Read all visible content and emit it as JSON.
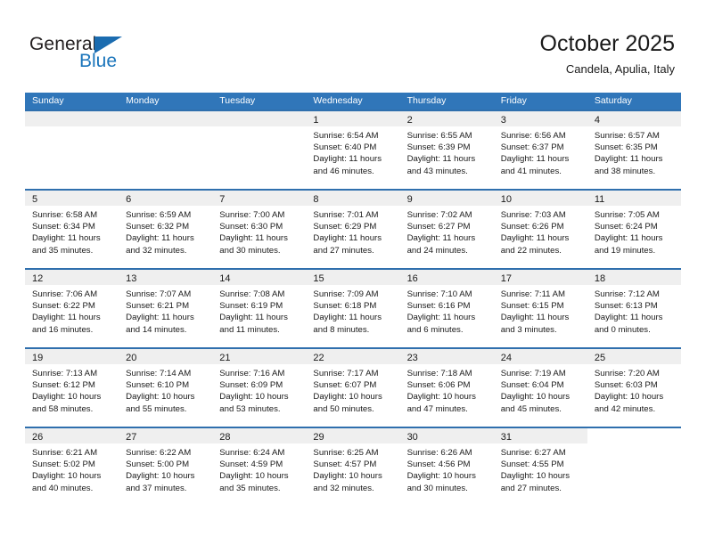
{
  "brand": {
    "name_part1": "General",
    "name_part2": "Blue",
    "triangle_color": "#1b6cb0",
    "blue_color": "#1b75bb"
  },
  "header": {
    "title": "October 2025",
    "subtitle": "Candela, Apulia, Italy",
    "accent_color": "#3076b9"
  },
  "weekdays": [
    "Sunday",
    "Monday",
    "Tuesday",
    "Wednesday",
    "Thursday",
    "Friday",
    "Saturday"
  ],
  "weeks": [
    [
      {
        "day": "",
        "blank": true
      },
      {
        "day": "",
        "blank": true
      },
      {
        "day": "",
        "blank": true
      },
      {
        "day": "1",
        "sunrise": "Sunrise: 6:54 AM",
        "sunset": "Sunset: 6:40 PM",
        "daylight1": "Daylight: 11 hours",
        "daylight2": "and 46 minutes."
      },
      {
        "day": "2",
        "sunrise": "Sunrise: 6:55 AM",
        "sunset": "Sunset: 6:39 PM",
        "daylight1": "Daylight: 11 hours",
        "daylight2": "and 43 minutes."
      },
      {
        "day": "3",
        "sunrise": "Sunrise: 6:56 AM",
        "sunset": "Sunset: 6:37 PM",
        "daylight1": "Daylight: 11 hours",
        "daylight2": "and 41 minutes."
      },
      {
        "day": "4",
        "sunrise": "Sunrise: 6:57 AM",
        "sunset": "Sunset: 6:35 PM",
        "daylight1": "Daylight: 11 hours",
        "daylight2": "and 38 minutes."
      }
    ],
    [
      {
        "day": "5",
        "sunrise": "Sunrise: 6:58 AM",
        "sunset": "Sunset: 6:34 PM",
        "daylight1": "Daylight: 11 hours",
        "daylight2": "and 35 minutes."
      },
      {
        "day": "6",
        "sunrise": "Sunrise: 6:59 AM",
        "sunset": "Sunset: 6:32 PM",
        "daylight1": "Daylight: 11 hours",
        "daylight2": "and 32 minutes."
      },
      {
        "day": "7",
        "sunrise": "Sunrise: 7:00 AM",
        "sunset": "Sunset: 6:30 PM",
        "daylight1": "Daylight: 11 hours",
        "daylight2": "and 30 minutes."
      },
      {
        "day": "8",
        "sunrise": "Sunrise: 7:01 AM",
        "sunset": "Sunset: 6:29 PM",
        "daylight1": "Daylight: 11 hours",
        "daylight2": "and 27 minutes."
      },
      {
        "day": "9",
        "sunrise": "Sunrise: 7:02 AM",
        "sunset": "Sunset: 6:27 PM",
        "daylight1": "Daylight: 11 hours",
        "daylight2": "and 24 minutes."
      },
      {
        "day": "10",
        "sunrise": "Sunrise: 7:03 AM",
        "sunset": "Sunset: 6:26 PM",
        "daylight1": "Daylight: 11 hours",
        "daylight2": "and 22 minutes."
      },
      {
        "day": "11",
        "sunrise": "Sunrise: 7:05 AM",
        "sunset": "Sunset: 6:24 PM",
        "daylight1": "Daylight: 11 hours",
        "daylight2": "and 19 minutes."
      }
    ],
    [
      {
        "day": "12",
        "sunrise": "Sunrise: 7:06 AM",
        "sunset": "Sunset: 6:22 PM",
        "daylight1": "Daylight: 11 hours",
        "daylight2": "and 16 minutes."
      },
      {
        "day": "13",
        "sunrise": "Sunrise: 7:07 AM",
        "sunset": "Sunset: 6:21 PM",
        "daylight1": "Daylight: 11 hours",
        "daylight2": "and 14 minutes."
      },
      {
        "day": "14",
        "sunrise": "Sunrise: 7:08 AM",
        "sunset": "Sunset: 6:19 PM",
        "daylight1": "Daylight: 11 hours",
        "daylight2": "and 11 minutes."
      },
      {
        "day": "15",
        "sunrise": "Sunrise: 7:09 AM",
        "sunset": "Sunset: 6:18 PM",
        "daylight1": "Daylight: 11 hours",
        "daylight2": "and 8 minutes."
      },
      {
        "day": "16",
        "sunrise": "Sunrise: 7:10 AM",
        "sunset": "Sunset: 6:16 PM",
        "daylight1": "Daylight: 11 hours",
        "daylight2": "and 6 minutes."
      },
      {
        "day": "17",
        "sunrise": "Sunrise: 7:11 AM",
        "sunset": "Sunset: 6:15 PM",
        "daylight1": "Daylight: 11 hours",
        "daylight2": "and 3 minutes."
      },
      {
        "day": "18",
        "sunrise": "Sunrise: 7:12 AM",
        "sunset": "Sunset: 6:13 PM",
        "daylight1": "Daylight: 11 hours",
        "daylight2": "and 0 minutes."
      }
    ],
    [
      {
        "day": "19",
        "sunrise": "Sunrise: 7:13 AM",
        "sunset": "Sunset: 6:12 PM",
        "daylight1": "Daylight: 10 hours",
        "daylight2": "and 58 minutes."
      },
      {
        "day": "20",
        "sunrise": "Sunrise: 7:14 AM",
        "sunset": "Sunset: 6:10 PM",
        "daylight1": "Daylight: 10 hours",
        "daylight2": "and 55 minutes."
      },
      {
        "day": "21",
        "sunrise": "Sunrise: 7:16 AM",
        "sunset": "Sunset: 6:09 PM",
        "daylight1": "Daylight: 10 hours",
        "daylight2": "and 53 minutes."
      },
      {
        "day": "22",
        "sunrise": "Sunrise: 7:17 AM",
        "sunset": "Sunset: 6:07 PM",
        "daylight1": "Daylight: 10 hours",
        "daylight2": "and 50 minutes."
      },
      {
        "day": "23",
        "sunrise": "Sunrise: 7:18 AM",
        "sunset": "Sunset: 6:06 PM",
        "daylight1": "Daylight: 10 hours",
        "daylight2": "and 47 minutes."
      },
      {
        "day": "24",
        "sunrise": "Sunrise: 7:19 AM",
        "sunset": "Sunset: 6:04 PM",
        "daylight1": "Daylight: 10 hours",
        "daylight2": "and 45 minutes."
      },
      {
        "day": "25",
        "sunrise": "Sunrise: 7:20 AM",
        "sunset": "Sunset: 6:03 PM",
        "daylight1": "Daylight: 10 hours",
        "daylight2": "and 42 minutes."
      }
    ],
    [
      {
        "day": "26",
        "sunrise": "Sunrise: 6:21 AM",
        "sunset": "Sunset: 5:02 PM",
        "daylight1": "Daylight: 10 hours",
        "daylight2": "and 40 minutes."
      },
      {
        "day": "27",
        "sunrise": "Sunrise: 6:22 AM",
        "sunset": "Sunset: 5:00 PM",
        "daylight1": "Daylight: 10 hours",
        "daylight2": "and 37 minutes."
      },
      {
        "day": "28",
        "sunrise": "Sunrise: 6:24 AM",
        "sunset": "Sunset: 4:59 PM",
        "daylight1": "Daylight: 10 hours",
        "daylight2": "and 35 minutes."
      },
      {
        "day": "29",
        "sunrise": "Sunrise: 6:25 AM",
        "sunset": "Sunset: 4:57 PM",
        "daylight1": "Daylight: 10 hours",
        "daylight2": "and 32 minutes."
      },
      {
        "day": "30",
        "sunrise": "Sunrise: 6:26 AM",
        "sunset": "Sunset: 4:56 PM",
        "daylight1": "Daylight: 10 hours",
        "daylight2": "and 30 minutes."
      },
      {
        "day": "31",
        "sunrise": "Sunrise: 6:27 AM",
        "sunset": "Sunset: 4:55 PM",
        "daylight1": "Daylight: 10 hours",
        "daylight2": "and 27 minutes."
      },
      {
        "day": "",
        "blank": true,
        "nostrip": true
      }
    ]
  ]
}
